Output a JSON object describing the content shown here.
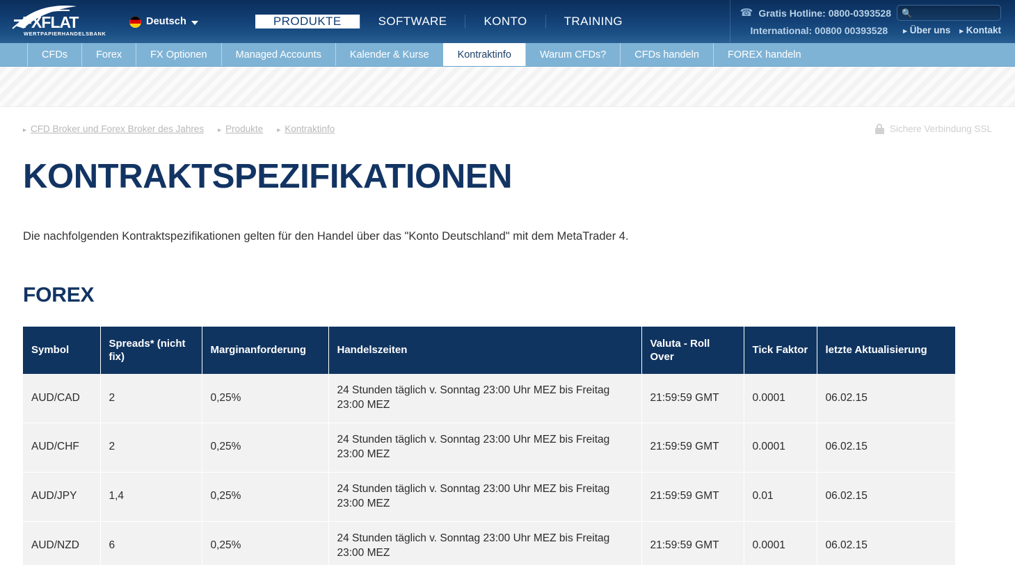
{
  "brand": {
    "name": "FXFLAT",
    "tagline": "WERTPAPIERHANDELSBANK"
  },
  "header": {
    "language": {
      "label": "Deutsch",
      "flag_icon": "german-flag-icon",
      "caret_icon": "chevron-down-icon"
    },
    "main_nav": [
      {
        "label": "PRODUKTE",
        "active": true
      },
      {
        "label": "SOFTWARE",
        "active": false
      },
      {
        "label": "KONTO",
        "active": false
      },
      {
        "label": "TRAINING",
        "active": false
      }
    ],
    "contact": {
      "phone_icon": "telephone-icon",
      "hotline": "Gratis Hotline: 0800-0393528",
      "international": "International: 00800 00393528"
    },
    "search": {
      "icon": "search-icon",
      "value": "",
      "placeholder": ""
    },
    "meta_links": [
      {
        "label": "Über uns"
      },
      {
        "label": "Kontakt"
      }
    ]
  },
  "subnav": [
    {
      "label": "CFDs",
      "active": false
    },
    {
      "label": "Forex",
      "active": false
    },
    {
      "label": "FX Optionen",
      "active": false
    },
    {
      "label": "Managed Accounts",
      "active": false
    },
    {
      "label": "Kalender & Kurse",
      "active": false
    },
    {
      "label": "Kontraktinfo",
      "active": true
    },
    {
      "label": "Warum CFDs?",
      "active": false
    },
    {
      "label": "CFDs handeln",
      "active": false
    },
    {
      "label": "FOREX handeln",
      "active": false
    }
  ],
  "breadcrumb": [
    {
      "label": "CFD Broker und Forex Broker des Jahres"
    },
    {
      "label": "Produkte"
    },
    {
      "label": "Kontraktinfo"
    }
  ],
  "ssl": {
    "icon": "lock-icon",
    "label": "Sichere Verbindung SSL"
  },
  "main": {
    "page_title": "KONTRAKTSPEZIFIKATIONEN",
    "intro": "Die nachfolgenden Kontraktspezifikationen gelten für den Handel über das \"Konto Deutschland\" mit dem MetaTrader 4.",
    "section_title": "FOREX"
  },
  "table": {
    "columns": [
      "Symbol",
      "Spreads* (nicht fix)",
      "Marginanforderung",
      "Handelszeiten",
      "Valuta - Roll Over",
      "Tick Faktor",
      "letzte Aktualisierung"
    ],
    "rows": [
      {
        "symbol": "AUD/CAD",
        "spread": "2",
        "margin": "0,25%",
        "hours": "24 Stunden täglich v. Sonntag 23:00 Uhr MEZ bis Freitag 23:00 MEZ",
        "valuta": "21:59:59 GMT",
        "tick": "0.0001",
        "updated": "06.02.15"
      },
      {
        "symbol": "AUD/CHF",
        "spread": "2",
        "margin": "0,25%",
        "hours": "24 Stunden täglich v. Sonntag 23:00 Uhr MEZ bis Freitag 23:00 MEZ",
        "valuta": "21:59:59 GMT",
        "tick": "0.0001",
        "updated": "06.02.15"
      },
      {
        "symbol": "AUD/JPY",
        "spread": "1,4",
        "margin": "0,25%",
        "hours": "24 Stunden täglich v. Sonntag 23:00 Uhr MEZ bis Freitag 23:00 MEZ",
        "valuta": "21:59:59 GMT",
        "tick": "0.01",
        "updated": "06.02.15"
      },
      {
        "symbol": "AUD/NZD",
        "spread": "6",
        "margin": "0,25%",
        "hours": "24 Stunden täglich v. Sonntag 23:00 Uhr MEZ bis Freitag 23:00 MEZ",
        "valuta": "21:59:59 GMT",
        "tick": "0.0001",
        "updated": "06.02.15"
      }
    ]
  },
  "colors": {
    "header_dark": "#123f74",
    "subnav_blue": "#7fb3d5",
    "title_navy": "#123463",
    "table_header": "#103460",
    "row_bg": "#f2f2f2"
  }
}
